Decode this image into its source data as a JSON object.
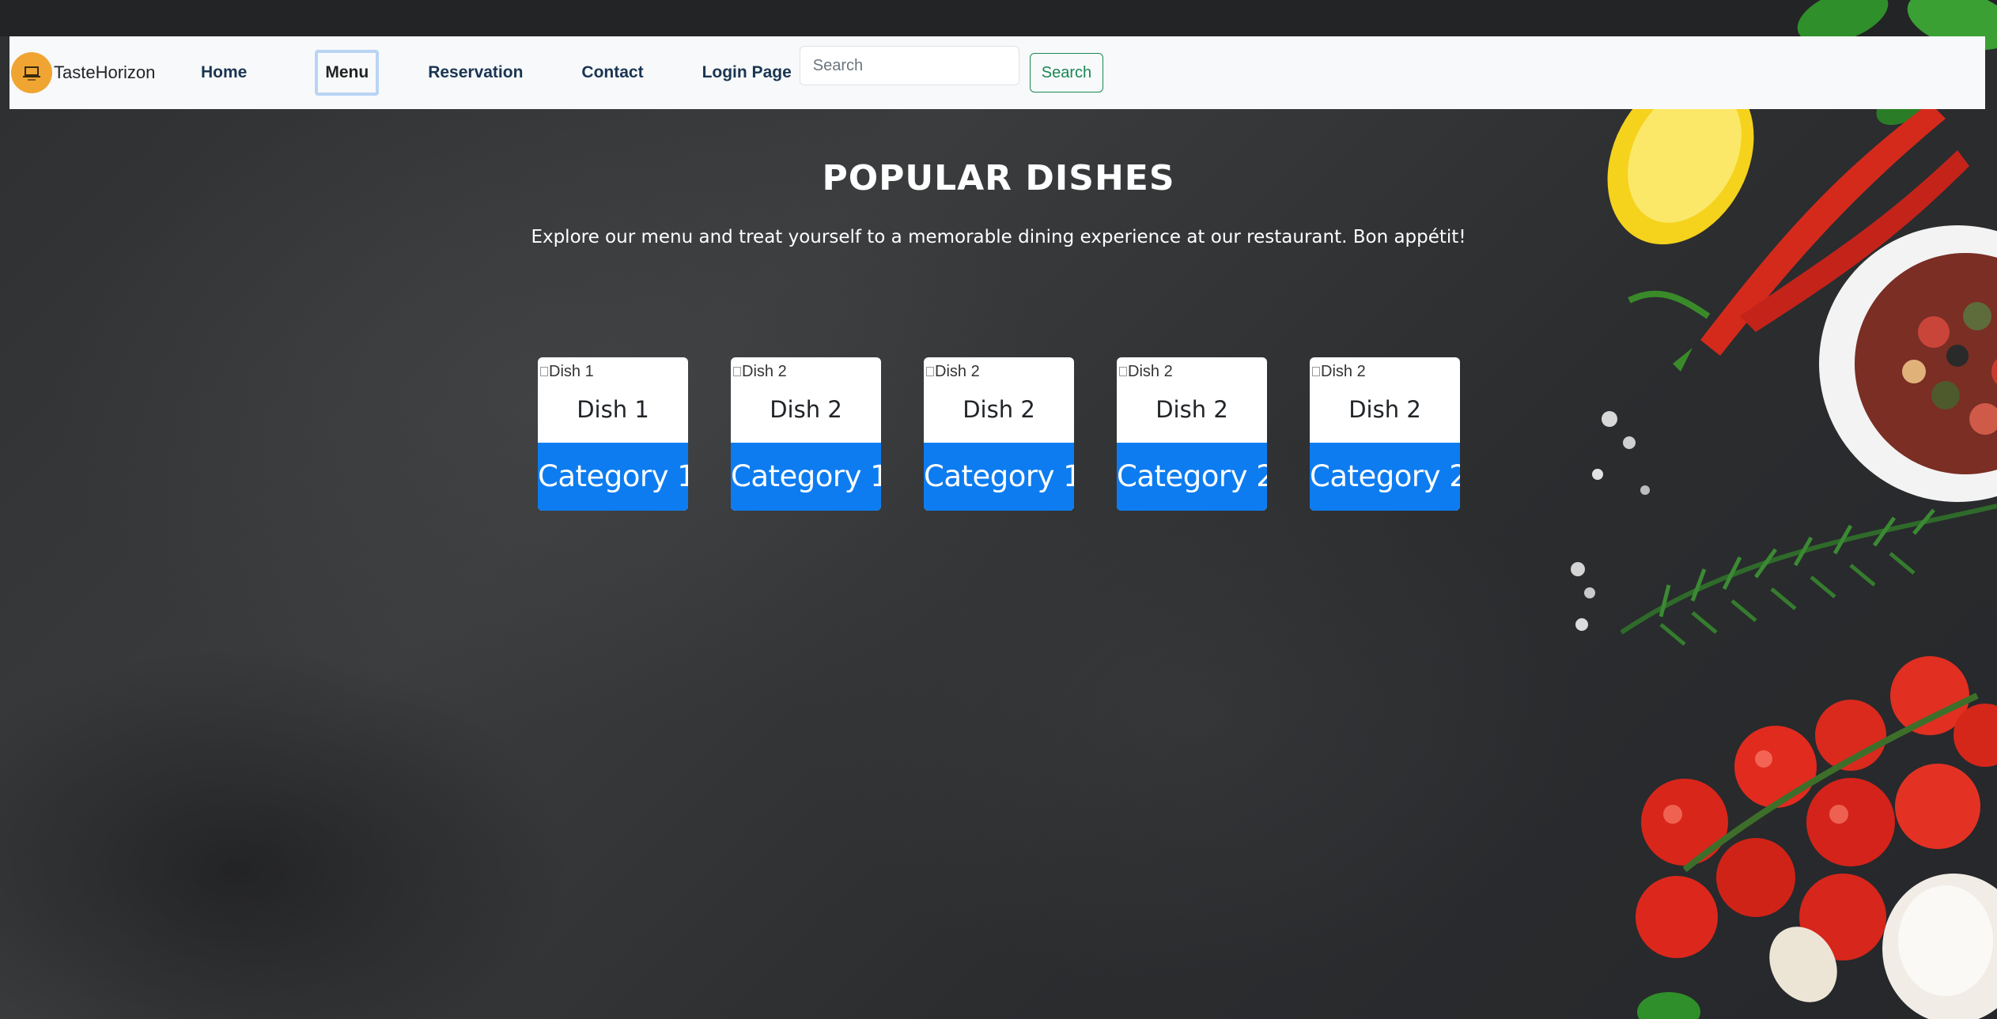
{
  "navbar": {
    "brand_name": "TasteHorizon",
    "links": {
      "home": "Home",
      "menu": "Menu",
      "reservation": "Reservation",
      "contact": "Contact",
      "login": "Login Page"
    },
    "search": {
      "placeholder": "Search",
      "value": "",
      "button_label": "Search"
    }
  },
  "hero": {
    "title": "POPULAR DISHES",
    "subtitle": "Explore our menu and treat yourself to a memorable dining experience at our restaurant. Bon appétit!"
  },
  "dishes": [
    {
      "image_alt": "Dish 1",
      "name": "Dish 1",
      "category": "Category 1"
    },
    {
      "image_alt": "Dish 2",
      "name": "Dish 2",
      "category": "Category 1"
    },
    {
      "image_alt": "Dish 2",
      "name": "Dish 2",
      "category": "Category 1"
    },
    {
      "image_alt": "Dish 2",
      "name": "Dish 2",
      "category": "Category 2"
    },
    {
      "image_alt": "Dish 2",
      "name": "Dish 2",
      "category": "Category 2"
    }
  ],
  "colors": {
    "navbar_bg": "#f8f9fa",
    "category_bg": "#0d7cf0",
    "search_button": "#198754",
    "background": "#2d2f31"
  },
  "icons": {
    "brand": "restaurant-logo-icon"
  }
}
